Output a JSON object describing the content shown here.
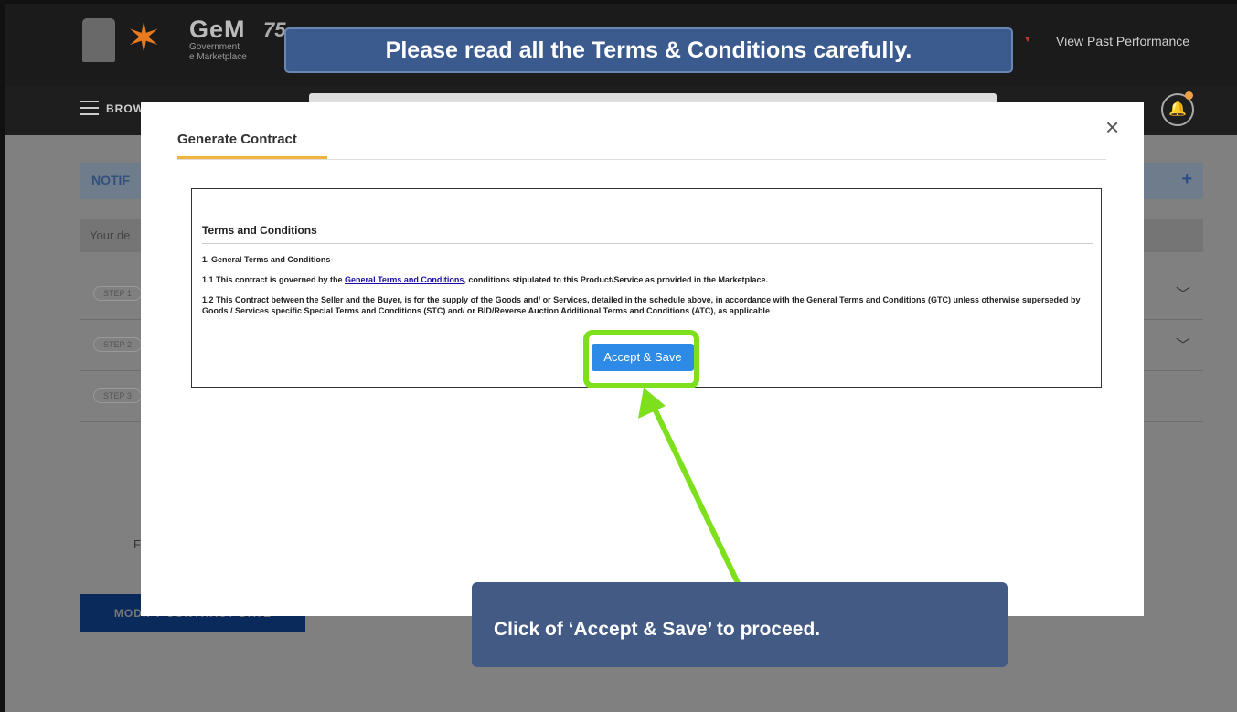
{
  "header": {
    "logo_text": "GeM",
    "logo_sub1": "Government",
    "logo_sub2": "e Marketplace",
    "azadi_text": "75",
    "view_past_performance": "View Past Performance"
  },
  "nav": {
    "browse_label": "BROW"
  },
  "background": {
    "notification_label": "NOTIF",
    "notification_plus": "+",
    "your_details_label": "Your de",
    "steps": [
      "STEP 1",
      "STEP 2",
      "STEP 3"
    ],
    "f_letter": "F",
    "modify_button": "MODIFY CONTRACT DATE"
  },
  "modal": {
    "title": "Generate Contract",
    "close_symbol": "×",
    "terms_heading": "Terms and Conditions",
    "line1": "1. General Terms and Conditions-",
    "line2_prefix": "1.1 This contract is governed by the ",
    "line2_link": "General Terms and Conditions",
    "line2_suffix": ", conditions stipulated to this Product/Service as provided in the Marketplace.",
    "line3": "1.2 This Contract between the Seller and the Buyer, is for the supply of the Goods and/ or Services, detailed in the schedule above, in accordance with the General Terms and Conditions (GTC) unless otherwise superseded by Goods / Services specific Special Terms and Conditions (STC) and/ or BID/Reverse Auction Additional Terms and Conditions (ATC), as applicable",
    "accept_button": "Accept & Save"
  },
  "tutorial": {
    "top_banner": "Please read all the Terms & Conditions carefully.",
    "bottom_banner": "Click of ‘Accept & Save’ to proceed.",
    "highlight_color": "#7ee01d",
    "banner_color": "#3b5a8e"
  }
}
